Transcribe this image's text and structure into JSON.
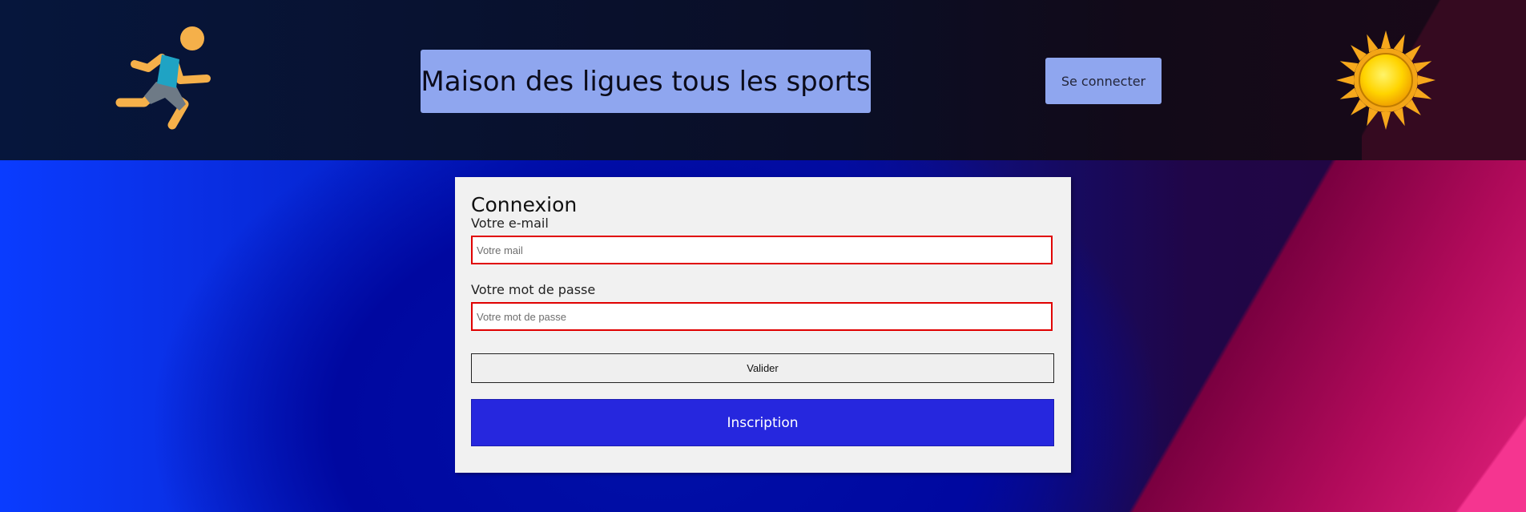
{
  "header": {
    "title": "Maison des ligues tous les sports",
    "login_label": "Se connecter",
    "left_icon": "runner-icon",
    "right_icon": "sun-icon"
  },
  "login_form": {
    "heading": "Connexion",
    "email_label": "Votre e-mail",
    "email_placeholder": "Votre mail",
    "email_value": "",
    "password_label": "Votre mot de passe",
    "password_placeholder": "Votre mot de passe",
    "password_value": "",
    "submit_label": "Valider",
    "signup_label": "Inscription"
  },
  "colors": {
    "title_box": "#8fa6ef",
    "signup_button": "#2627de",
    "input_border_error": "#e00000",
    "card_background": "#f1f1f1"
  }
}
